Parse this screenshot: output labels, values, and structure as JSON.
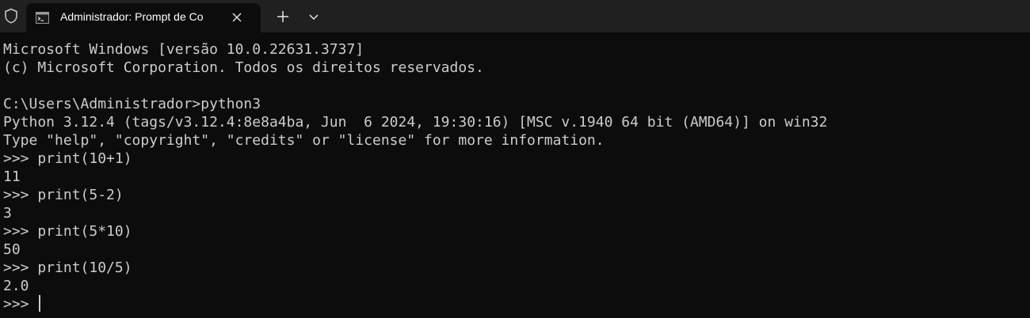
{
  "tab": {
    "title": "Administrador: Prompt de Co",
    "icon": "cmd-terminal-icon"
  },
  "colors": {
    "tabbar_bg": "#202020",
    "console_bg": "#0c0c0c",
    "console_fg": "#cccccc"
  },
  "console": {
    "lines": [
      "Microsoft Windows [versão 10.0.22631.3737]",
      "(c) Microsoft Corporation. Todos os direitos reservados.",
      "",
      "C:\\Users\\Administrador>python3",
      "Python 3.12.4 (tags/v3.12.4:8e8a4ba, Jun  6 2024, 19:30:16) [MSC v.1940 64 bit (AMD64)] on win32",
      "Type \"help\", \"copyright\", \"credits\" or \"license\" for more information.",
      ">>> print(10+1)",
      "11",
      ">>> print(5-2)",
      "3",
      ">>> print(5*10)",
      "50",
      ">>> print(10/5)",
      "2.0"
    ],
    "prompt": ">>> "
  }
}
